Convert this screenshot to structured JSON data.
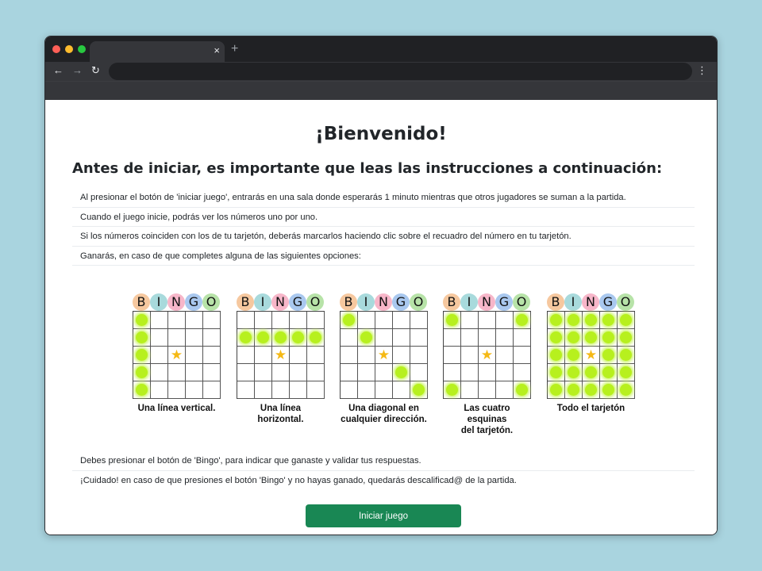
{
  "browser": {
    "colors": {
      "close": "#ff5f57",
      "minimize": "#febc2e",
      "maximize": "#28c840"
    },
    "tab_close": "×",
    "new_tab": "+",
    "back": "←",
    "forward": "→",
    "reload": "↻",
    "menu": "⋮"
  },
  "page": {
    "title": "¡Bienvenido!",
    "subtitle": "Antes de iniciar, es importante que leas las instrucciones a continuación:",
    "instructions": [
      "Al presionar el botón de 'iniciar juego', entrarás en una sala donde esperarás 1 minuto mientras que otros jugadores se suman a la partida.",
      "Cuando el juego inicie, podrás ver los números uno por uno.",
      "Si los números coinciden con los de tu tarjetón, deberás marcarlos haciendo clic sobre el recuadro del número en tu tarjetón.",
      "Ganarás, en caso de que completes alguna de las siguientes opciones:"
    ],
    "bingo_letters": [
      "B",
      "I",
      "N",
      "G",
      "O"
    ],
    "letter_colors": [
      "#f6c89f",
      "#a8dadc",
      "#f7b6c9",
      "#a9c8ef",
      "#b7e3a8"
    ],
    "patterns": [
      {
        "caption_lines": [
          "Una línea vertical."
        ],
        "marked": [
          [
            0,
            0
          ],
          [
            1,
            0
          ],
          [
            2,
            0
          ],
          [
            3,
            0
          ],
          [
            4,
            0
          ]
        ]
      },
      {
        "caption_lines": [
          "Una línea horizontal."
        ],
        "marked": [
          [
            1,
            0
          ],
          [
            1,
            1
          ],
          [
            1,
            2
          ],
          [
            1,
            3
          ],
          [
            1,
            4
          ]
        ]
      },
      {
        "caption_lines": [
          "Una diagonal en",
          "cualquier dirección."
        ],
        "marked": [
          [
            0,
            0
          ],
          [
            1,
            1
          ],
          [
            3,
            3
          ],
          [
            4,
            4
          ]
        ]
      },
      {
        "caption_lines": [
          "Las cuatro esquinas",
          "del tarjetón."
        ],
        "marked": [
          [
            0,
            0
          ],
          [
            0,
            4
          ],
          [
            4,
            0
          ],
          [
            4,
            4
          ]
        ]
      },
      {
        "caption_lines": [
          "Todo el tarjetón"
        ],
        "marked": "all"
      }
    ],
    "warnings": [
      "Debes presionar el botón de 'Bingo', para indicar que ganaste y validar tus respuestas.",
      "¡Cuidado! en caso de que presiones el botón 'Bingo' y no hayas ganado, quedarás descalificad@ de la partida."
    ],
    "start_button": "Iniciar juego",
    "star_symbol": "★"
  }
}
